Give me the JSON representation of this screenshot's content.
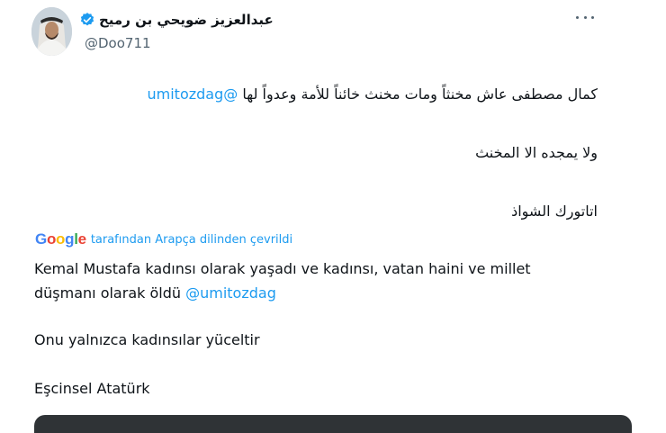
{
  "author": {
    "display_name": "عبدالعزيز ضويحي بن رميح",
    "handle": "@Doo711",
    "avatar_icon": "user-avatar",
    "verified_icon": "verified-badge-icon",
    "more_icon": "more-options-icon"
  },
  "tweet": {
    "arabic_line1_text": "كمال مصطفى عاش مخنثاً ومات مخنث خائناً للأمة وعدواً لها",
    "arabic_line1_mention": "@umitozdag",
    "arabic_line2": "ولا يمجده الا المخنث",
    "arabic_line3": "اتاتورك الشواذ"
  },
  "translation": {
    "provider_logo": "Google",
    "label": "tarafından Arapça dilinden çevrildi",
    "turkish_line1": "Kemal Mustafa kadınsı olarak yaşadı ve kadınsı, vatan haini ve millet",
    "turkish_line2_text": "düşmanı olarak öldü",
    "turkish_line2_mention": "@umitozdag",
    "turkish_line3": "Onu yalnızca kadınsılar yüceltir",
    "turkish_line4": "Eşcinsel Atatürk"
  },
  "colors": {
    "accent": "#1d9bf0",
    "text": "#0f1419",
    "muted": "#536471"
  }
}
